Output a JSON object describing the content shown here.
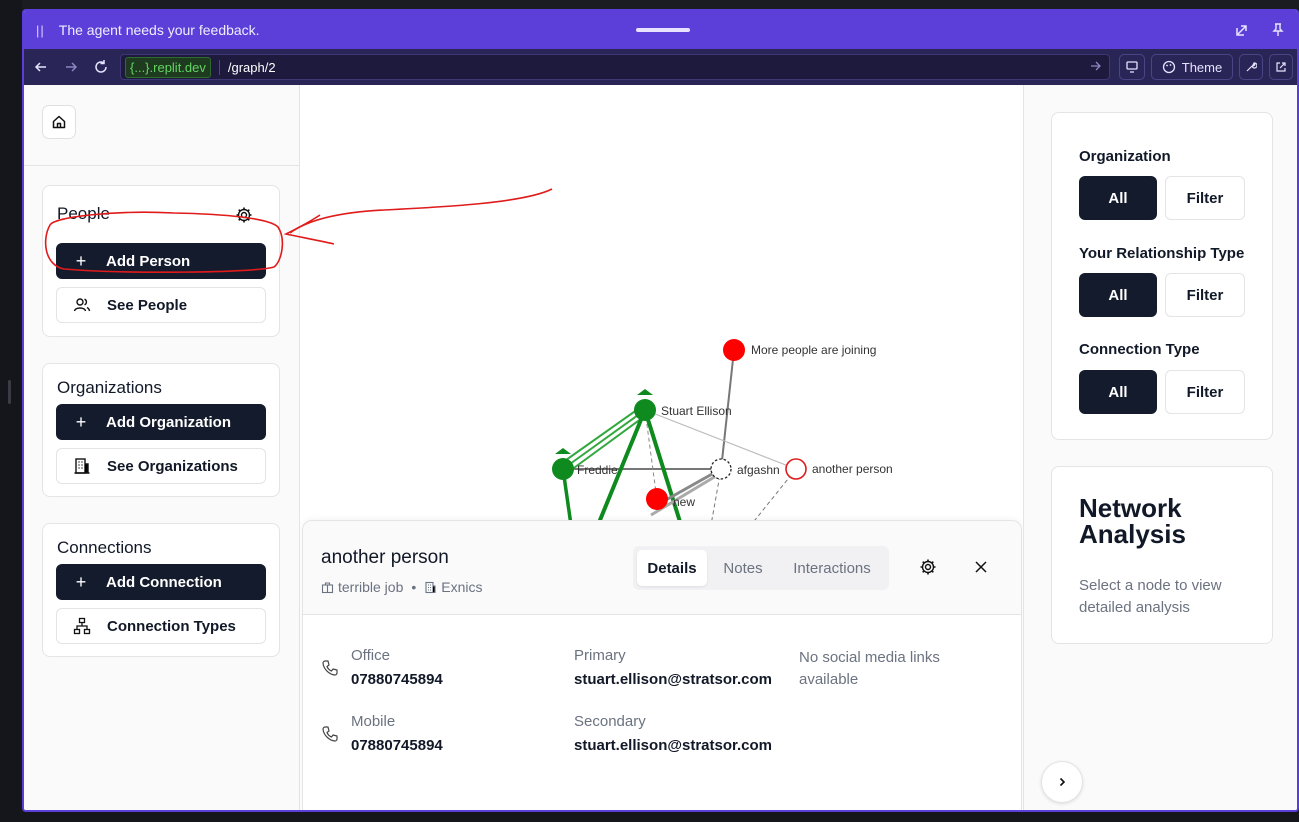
{
  "agent_bar": {
    "pause_glyph": "||",
    "message": "The agent needs your feedback."
  },
  "url_bar": {
    "host": "{...}.replit.dev",
    "path": "/graph/2",
    "theme_label": "Theme"
  },
  "sidebar": {
    "people": {
      "title": "People",
      "add_label": "Add Person",
      "see_label": "See People"
    },
    "organizations": {
      "title": "Organizations",
      "add_label": "Add Organization",
      "see_label": "See Organizations"
    },
    "connections": {
      "title": "Connections",
      "add_label": "Add Connection",
      "types_label": "Connection Types"
    },
    "plus_glyph": "+"
  },
  "graph": {
    "nodes": {
      "more_people": "More people are joining",
      "stuart": "Stuart Ellison",
      "freddie": "Freddie",
      "afgashn": "afgashn",
      "another_person": "another person",
      "new": "new"
    }
  },
  "detail": {
    "name": "another person",
    "job": "terrible job",
    "separator": "•",
    "organization": "Exnics",
    "tabs": [
      "Details",
      "Notes",
      "Interactions"
    ],
    "phones": [
      {
        "label": "Office",
        "value": "07880745894"
      },
      {
        "label": "Mobile",
        "value": "07880745894"
      }
    ],
    "emails": [
      {
        "label": "Primary",
        "value": "stuart.ellison@stratsor.com"
      },
      {
        "label": "Secondary",
        "value": "stuart.ellison@stratsor.com"
      }
    ],
    "social": "No social media links available"
  },
  "filters": {
    "organization": {
      "label": "Organization",
      "all": "All",
      "filter": "Filter"
    },
    "relationship": {
      "label": "Your Relationship Type",
      "all": "All",
      "filter": "Filter"
    },
    "connection": {
      "label": "Connection Type",
      "all": "All",
      "filter": "Filter"
    }
  },
  "analysis": {
    "title": "Network Analysis",
    "description": "Select a node to view detailed analysis"
  },
  "colors": {
    "accent": "#5b3fd8",
    "dark_button": "#141b2d",
    "node_green": "#0e8a1e",
    "node_red": "#ff0000",
    "annotation": "#e01b1b"
  }
}
